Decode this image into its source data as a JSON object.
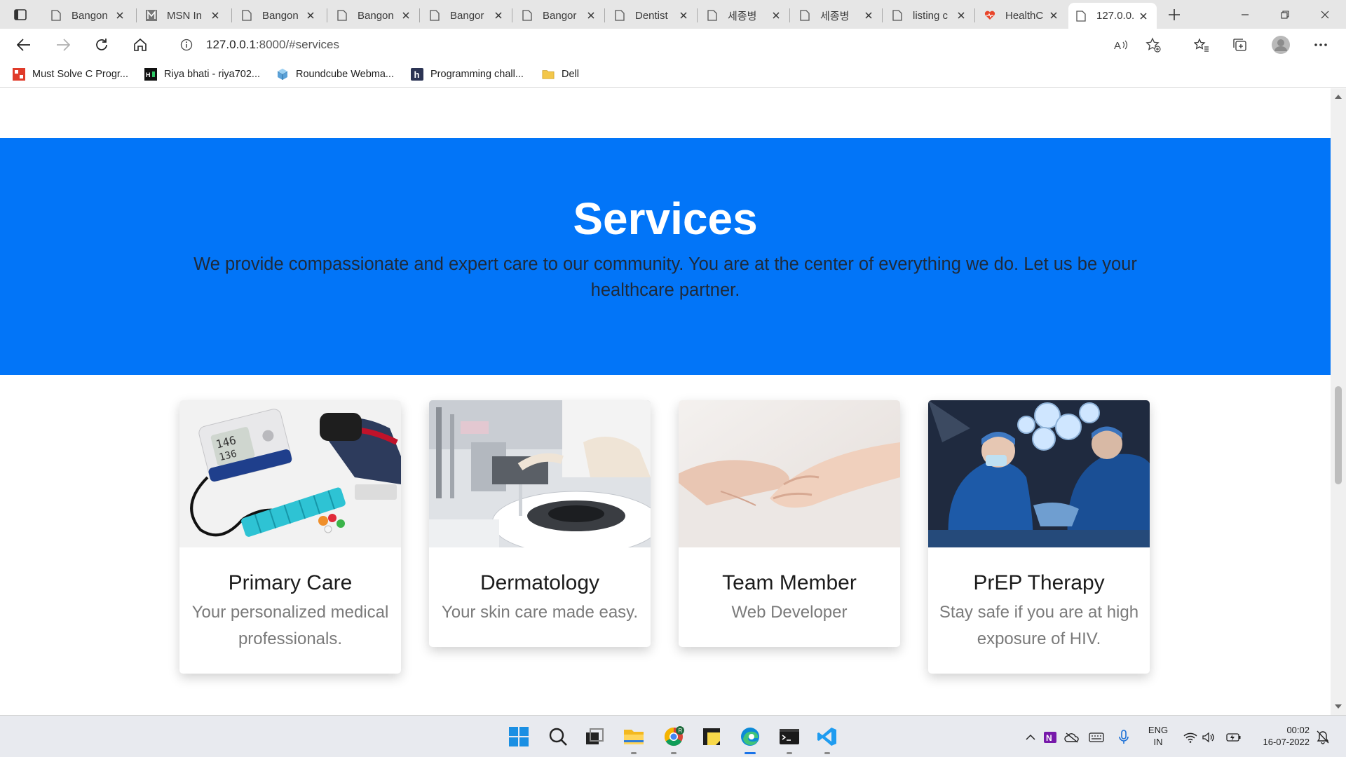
{
  "browser": {
    "tabs": [
      {
        "label": "Bangon",
        "icon": "page-icon"
      },
      {
        "label": "MSN In",
        "icon": "msn-icon"
      },
      {
        "label": "Bangon",
        "icon": "page-icon"
      },
      {
        "label": "Bangon",
        "icon": "page-icon"
      },
      {
        "label": "Bangor",
        "icon": "page-icon"
      },
      {
        "label": "Bangor",
        "icon": "page-icon"
      },
      {
        "label": "Dentist",
        "icon": "page-icon"
      },
      {
        "label": "세종병",
        "icon": "page-icon"
      },
      {
        "label": "세종병",
        "icon": "page-icon"
      },
      {
        "label": "listing c",
        "icon": "page-icon"
      },
      {
        "label": "HealthC",
        "icon": "heart-icon"
      },
      {
        "label": "127.0.0.",
        "icon": "page-icon",
        "active": true
      }
    ],
    "url_host": "127.0.0.1",
    "url_rest": ":8000/#services",
    "bookmarks": [
      {
        "label": "Must Solve C Progr...",
        "icon": "red-grid-icon"
      },
      {
        "label": "Riya bhati - riya702...",
        "icon": "hr-logo-icon"
      },
      {
        "label": "Roundcube Webma...",
        "icon": "roundcube-icon"
      },
      {
        "label": "Programming chall...",
        "icon": "h-logo-icon"
      },
      {
        "label": "Dell",
        "icon": "folder-icon"
      }
    ]
  },
  "page": {
    "section_title": "Services",
    "section_text": "We provide compassionate and expert care to our community. You are at the center of everything we do. Let us be your healthcare partner.",
    "accent_color": "#0275f8",
    "cards": [
      {
        "title": "Primary Care",
        "subtitle": "Your personalized medical professionals.",
        "image": "blood-pressure-monitor-image"
      },
      {
        "title": "Dermatology",
        "subtitle": "Your skin care made easy.",
        "image": "laboratory-image"
      },
      {
        "title": "Team Member",
        "subtitle": "Web Developer",
        "image": "holding-hands-image"
      },
      {
        "title": "PrEP Therapy",
        "subtitle": "Stay safe if you are at high exposure of HIV.",
        "image": "surgery-image"
      }
    ]
  },
  "taskbar": {
    "lang_top": "ENG",
    "lang_bottom": "IN",
    "time": "00:02",
    "date": "16-07-2022"
  }
}
